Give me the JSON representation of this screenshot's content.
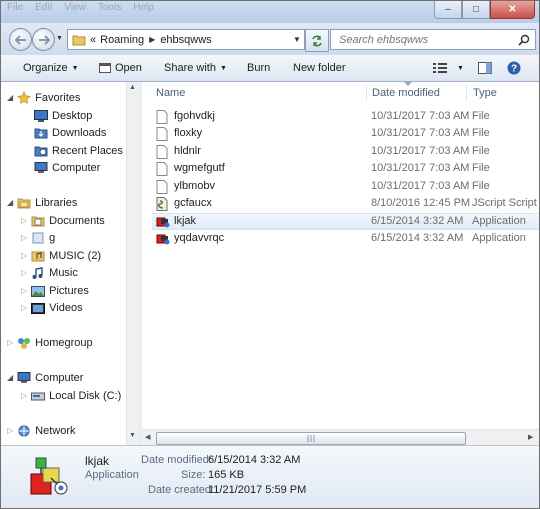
{
  "window": {
    "menu_ghost": [
      "File",
      "Edit",
      "View",
      "Tools",
      "Help"
    ],
    "min_glyph": "–",
    "max_glyph": "□",
    "close_glyph": "✕"
  },
  "address": {
    "overflow": "«",
    "crumbs": [
      "Roaming",
      "ehbsqwws"
    ],
    "search_placeholder": "Search ehbsqwws"
  },
  "toolbar": {
    "organize": "Organize",
    "open": "Open",
    "share_with": "Share with",
    "burn": "Burn",
    "new_folder": "New folder"
  },
  "nav": {
    "favorites": {
      "label": "Favorites",
      "items": [
        "Desktop",
        "Downloads",
        "Recent Places",
        "Computer"
      ]
    },
    "libraries": {
      "label": "Libraries",
      "items": [
        "Documents",
        "g",
        "MUSIC (2)",
        "Music",
        "Pictures",
        "Videos"
      ]
    },
    "homegroup": "Homegroup",
    "computer": {
      "label": "Computer",
      "items": [
        "Local Disk (C:)"
      ]
    },
    "network": "Network"
  },
  "columns": {
    "name": "Name",
    "date": "Date modified",
    "type": "Type"
  },
  "files": [
    {
      "name": "fgohvdkj",
      "date": "10/31/2017 7:03 AM",
      "type": "File",
      "icon": "blank-file-icon"
    },
    {
      "name": "floxky",
      "date": "10/31/2017 7:03 AM",
      "type": "File",
      "icon": "blank-file-icon"
    },
    {
      "name": "hldnlr",
      "date": "10/31/2017 7:03 AM",
      "type": "File",
      "icon": "blank-file-icon"
    },
    {
      "name": "wgmefgutf",
      "date": "10/31/2017 7:03 AM",
      "type": "File",
      "icon": "blank-file-icon"
    },
    {
      "name": "ylbmobv",
      "date": "10/31/2017 7:03 AM",
      "type": "File",
      "icon": "blank-file-icon"
    },
    {
      "name": "gcfaucx",
      "date": "8/10/2016 12:45 PM",
      "type": "JScript Script F",
      "icon": "script-file-icon"
    },
    {
      "name": "lkjak",
      "date": "6/15/2014 3:32 AM",
      "type": "Application",
      "icon": "application-icon"
    },
    {
      "name": "yqdavvrqc",
      "date": "6/15/2014 3:32 AM",
      "type": "Application",
      "icon": "application-icon"
    }
  ],
  "details": {
    "name": "lkjak",
    "kind": "Application",
    "modified_label": "Date modified:",
    "modified": "6/15/2014 3:32 AM",
    "size_label": "Size:",
    "size": "165 KB",
    "created_label": "Date created:",
    "created": "11/21/2017 5:59 PM"
  }
}
